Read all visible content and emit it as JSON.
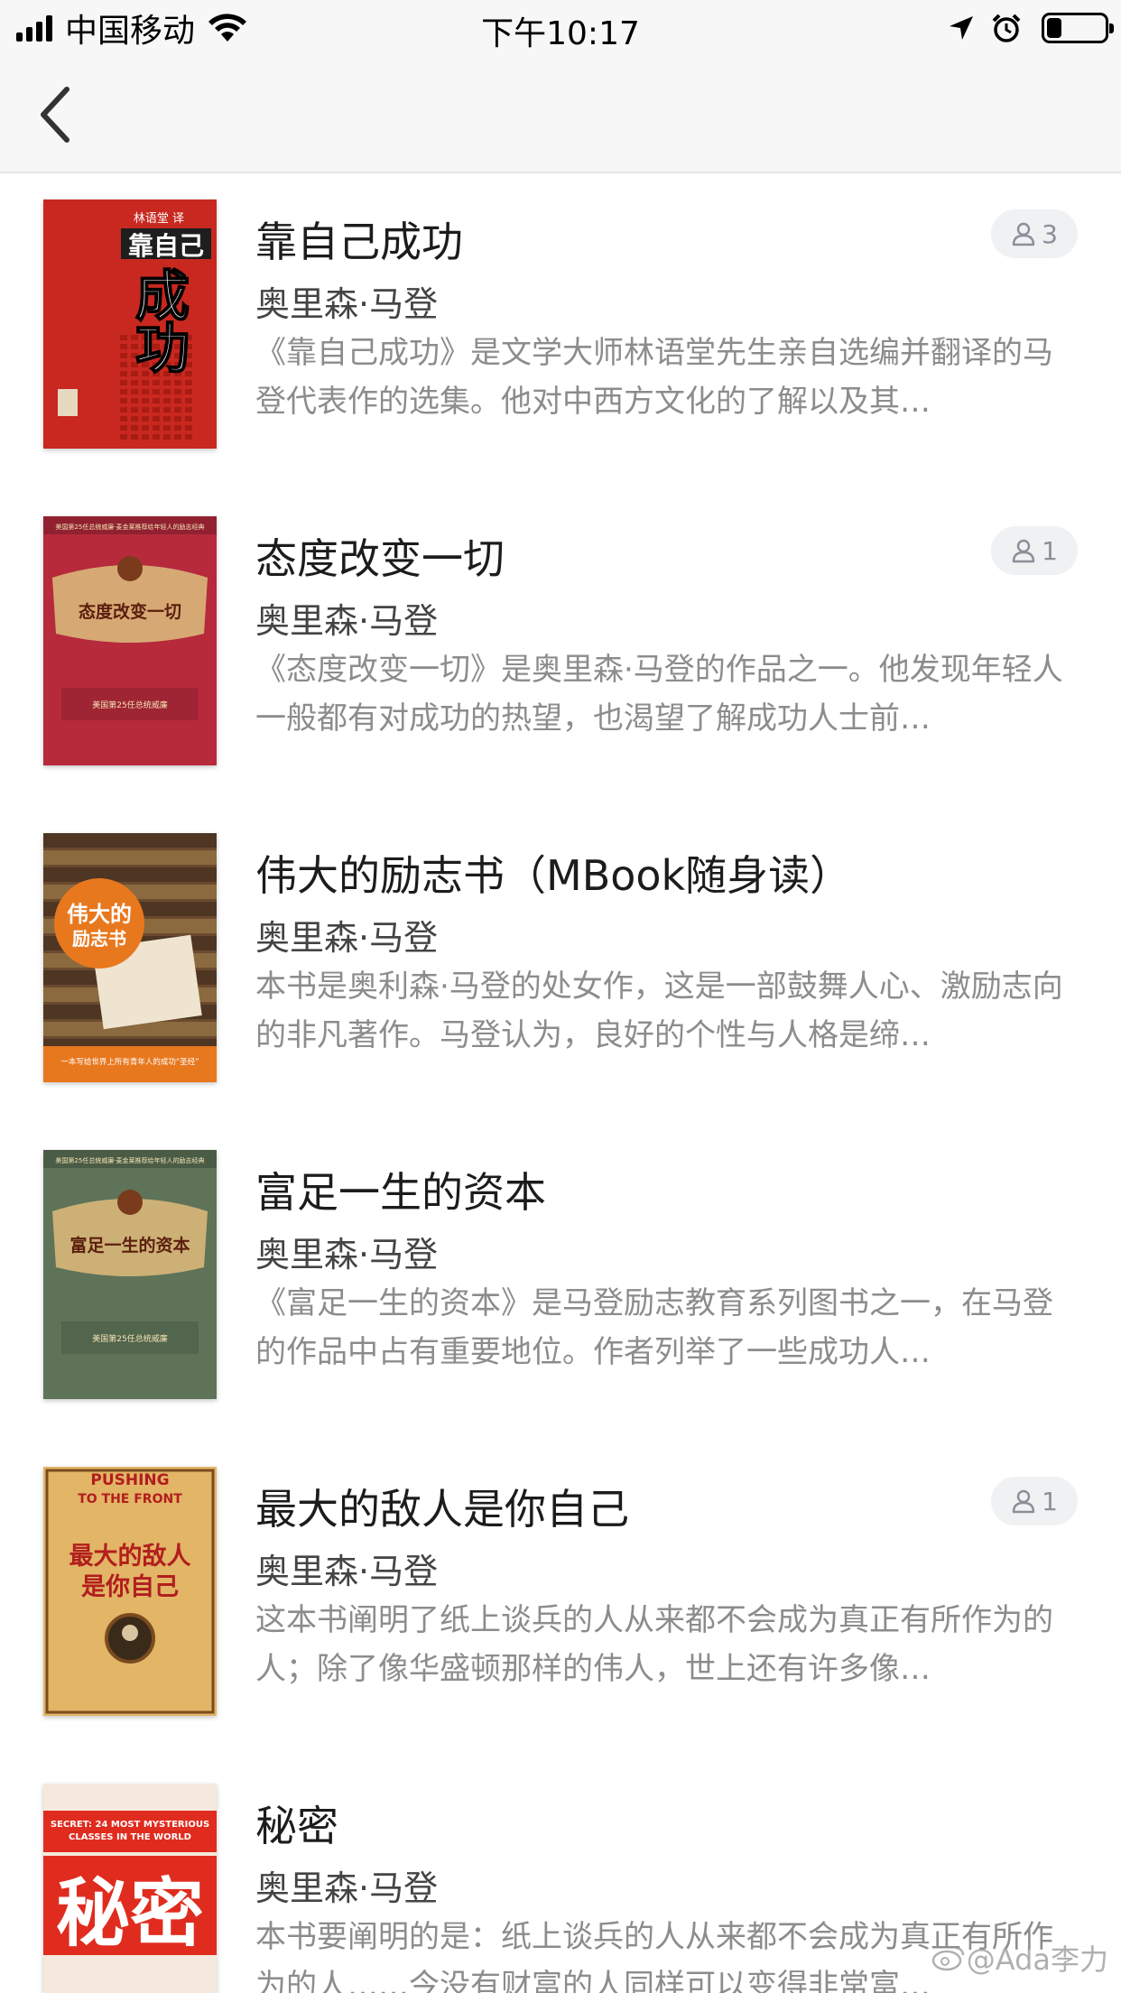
{
  "status_bar": {
    "carrier": "中国移动",
    "time": "下午10:17",
    "battery_level": 0.25
  },
  "nav": {
    "back_icon": "chevron-left-icon"
  },
  "books": [
    {
      "title": "靠自己成功",
      "author": "奥里森·马登",
      "description": "《靠自己成功》是文学大师林语堂先生亲自选编并翻译的马登代表作的选集。他对中西方文化的了解以及其…",
      "readers": "3",
      "cover": {
        "bg": "#c8281f",
        "accent": "#1e1e1e",
        "big_text": [
          "靠自己",
          "成",
          "功"
        ],
        "small_text": "林语堂 译"
      }
    },
    {
      "title": "态度改变一切",
      "author": "奥里森·马登",
      "description": "《态度改变一切》是奥里森·马登的作品之一。他发现年轻人一般都有对成功的热望，也渴望了解成功人士前…",
      "readers": "1",
      "cover": {
        "bg": "#b62a3c",
        "accent": "#d9b77a",
        "big_text": [
          "态度改变一切"
        ],
        "small_text": "美国第25任总统威廉·麦金莱推荐给年轻人的励志经典"
      }
    },
    {
      "title": "伟大的励志书（MBook随身读）",
      "author": "奥里森·马登",
      "description": "本书是奥利森·马登的处女作，这是一部鼓舞人心、激励志向的非凡著作。马登认为，良好的个性与人格是缔…",
      "readers": "",
      "cover": {
        "bg": "#6b4a2f",
        "accent": "#e8781e",
        "big_text": [
          "伟大的",
          "励志书"
        ],
        "small_text": "一本写给世界上所有青年人的成功“圣经”"
      }
    },
    {
      "title": "富足一生的资本",
      "author": "奥里森·马登",
      "description": "《富足一生的资本》是马登励志教育系列图书之一，在马登的作品中占有重要地位。作者列举了一些成功人…",
      "readers": "",
      "cover": {
        "bg": "#5e7358",
        "accent": "#d9b77a",
        "big_text": [
          "富足一生的资本"
        ],
        "small_text": "美国第25任总统威廉·麦金莱推荐给年轻人的励志经典"
      }
    },
    {
      "title": "最大的敌人是你自己",
      "author": "奥里森·马登",
      "description": "这本书阐明了纸上谈兵的人从来都不会成为真正有所作为的人；除了像华盛顿那样的伟人，世上还有许多像…",
      "readers": "1",
      "cover": {
        "bg": "#e2b567",
        "accent": "#b21e1e",
        "big_text": [
          "最大的敌人",
          "是你自己"
        ],
        "small_text": "PUSHING TO THE FRONT"
      }
    },
    {
      "title": "秘密",
      "author": "奥里森·马登",
      "description": "本书要阐明的是：纸上谈兵的人从来都不会成为真正有所作为的人……今没有财富的人同样可以变得非常富…",
      "readers": "",
      "cover": {
        "bg": "#f4e9dc",
        "accent": "#e02c1f",
        "big_text": [
          "秘密"
        ],
        "small_text": "SECRET: 24 MOST MYSTERIOUS CLASSES IN THE WORLD"
      }
    }
  ],
  "watermark": "@Ada李力"
}
